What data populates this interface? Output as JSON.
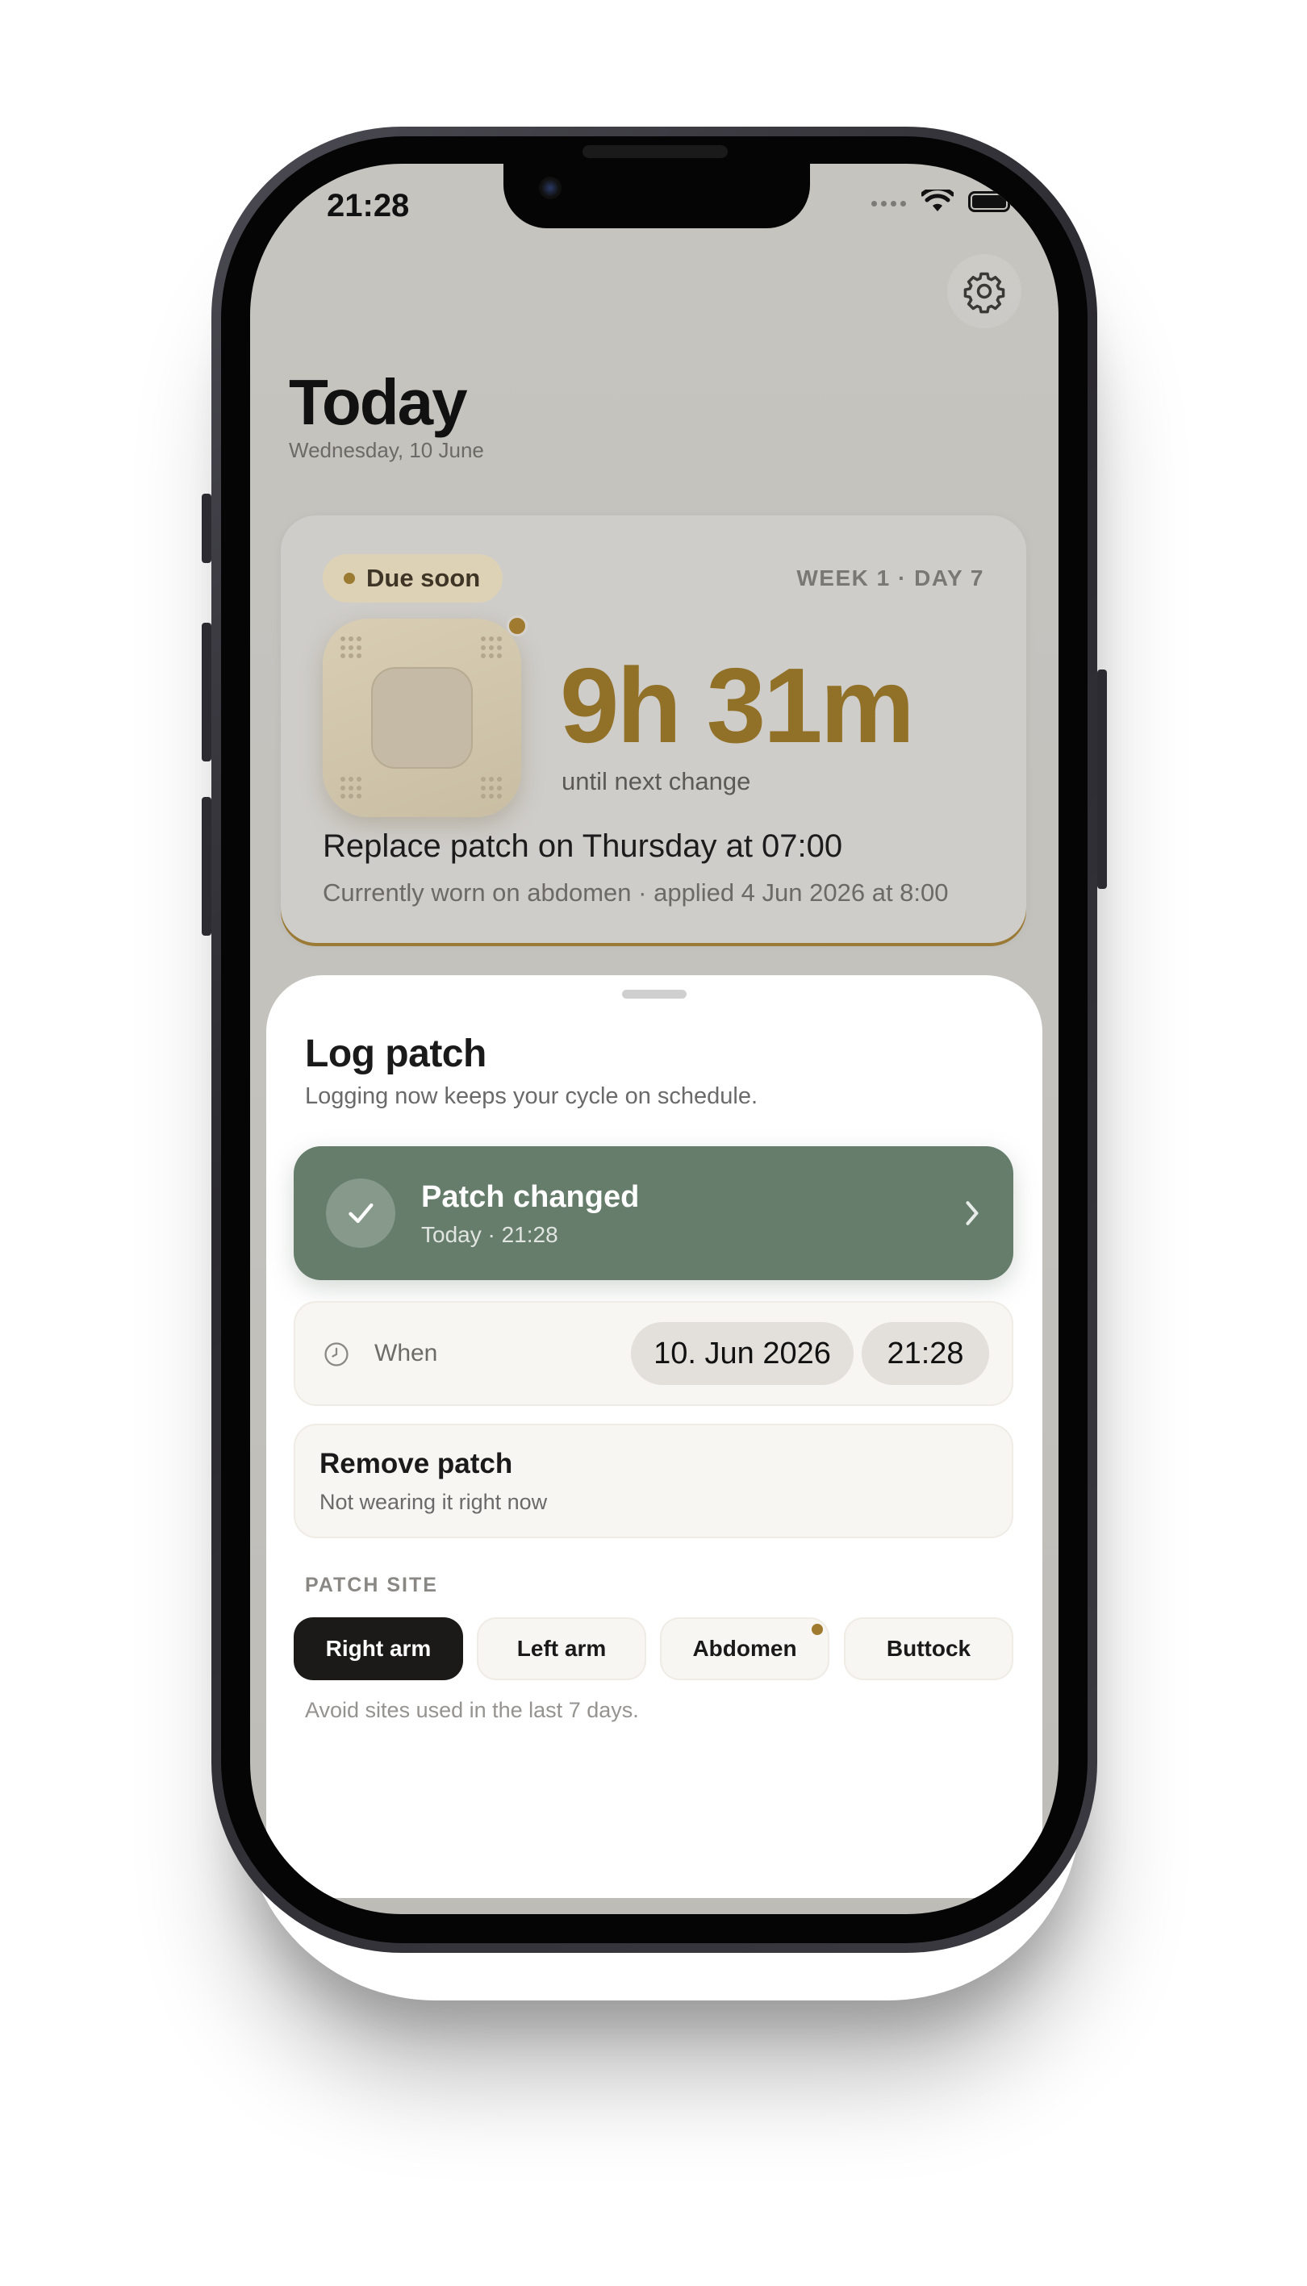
{
  "status_bar": {
    "time": "21:28"
  },
  "header": {
    "title": "Today",
    "date": "Wednesday, 10 June"
  },
  "icons": {
    "settings": "gear-icon",
    "wifi": "wifi-icon",
    "battery": "battery-icon",
    "check": "checkmark-icon",
    "chevron": "chevron-right-icon",
    "clock": "clock-icon"
  },
  "status_card": {
    "badge": "Due soon",
    "week_day": "WEEK 1 · DAY 7",
    "countdown": "9h 31m",
    "countdown_sub": "until next change",
    "replace_text": "Replace patch on Thursday at 07:00",
    "worn_text": "Currently worn on abdomen · applied 4 Jun 2026 at 8:00"
  },
  "sheet": {
    "title": "Log patch",
    "subtitle": "Logging now keeps your cycle on schedule.",
    "patch_changed": {
      "title": "Patch changed",
      "subtitle": "Today · 21:28"
    },
    "when": {
      "label": "When",
      "date": "10. Jun 2026",
      "time": "21:28"
    },
    "remove": {
      "title": "Remove patch",
      "subtitle": "Not wearing it right now"
    },
    "site": {
      "label": "PATCH SITE",
      "options": [
        "Right arm",
        "Left arm",
        "Abdomen",
        "Buttock"
      ],
      "selected": "Right arm",
      "current_marker": "Abdomen",
      "hint": "Avoid sites used in the last 7 days."
    }
  },
  "colors": {
    "accent_gold": "#917028",
    "sheet_green": "#667d6b",
    "active_site": "#1b1a18",
    "screen_bg": "#c6c4bf"
  }
}
